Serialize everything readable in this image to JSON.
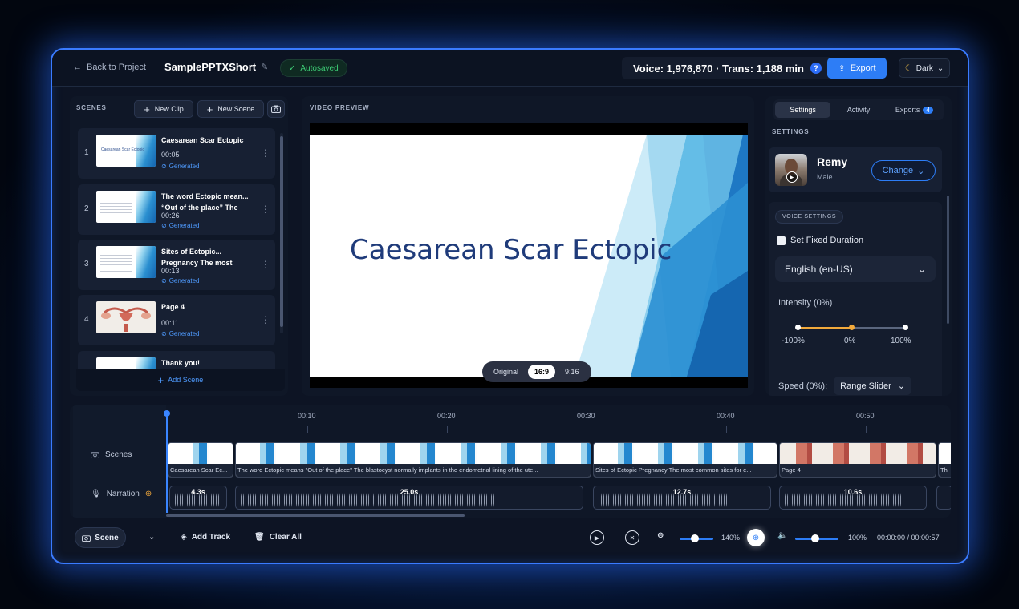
{
  "colors": {
    "accent": "#2d7df6",
    "success": "#3ecf77",
    "warning": "#f2a93b",
    "frame_glow": "#3a7bff"
  },
  "topbar": {
    "back_label": "Back to Project",
    "project_title": "SamplePPTXShort",
    "autosaved": "Autosaved",
    "usage": "Voice: 1,976,870 · Trans: 1,188 min",
    "help_icon": "?",
    "export_label": "Export",
    "theme_label": "Dark"
  },
  "scenes": {
    "label": "SCENES",
    "new_clip": "New Clip",
    "new_scene": "New Scene",
    "add_scene": "Add Scene",
    "items": [
      {
        "num": "1",
        "title": "Caesarean Scar Ectopic",
        "time": "00:05",
        "status": "Generated"
      },
      {
        "num": "2",
        "title": "The word Ectopic mean... “Out of the place” The",
        "time": "00:26",
        "status": "Generated"
      },
      {
        "num": "3",
        "title": "Sites of Ectopic... Pregnancy The most",
        "time": "00:13",
        "status": "Generated"
      },
      {
        "num": "4",
        "title": "Page 4",
        "time": "00:11",
        "status": "Generated"
      },
      {
        "num": "",
        "title": "Thank you!",
        "time": "",
        "status": ""
      }
    ],
    "thumb_title": "Caesarean Scar Ectopic"
  },
  "preview": {
    "label": "VIDEO PREVIEW",
    "slide_title": "Caesarean Scar Ectopic",
    "ratios": [
      "Original",
      "16:9",
      "9:16"
    ],
    "active_ratio": "16:9"
  },
  "settings": {
    "tabs": [
      {
        "label": "Settings"
      },
      {
        "label": "Activity"
      },
      {
        "label": "Exports",
        "badge": "4"
      }
    ],
    "section_label": "SETTINGS",
    "voice_name": "Remy",
    "voice_gender": "Male",
    "change_label": "Change",
    "voice_settings_chip": "VOICE SETTINGS",
    "fixed_duration": "Set Fixed Duration",
    "language": "English (en-US)",
    "intensity_label": "Intensity (0%)",
    "intensity_ticks": [
      "-100%",
      "0%",
      "100%"
    ],
    "intensity_value": 0,
    "speed_label": "Speed (0%):",
    "speed_select": "Range Slider"
  },
  "timeline": {
    "ticks": [
      "00:10",
      "00:20",
      "00:30",
      "00:40",
      "00:50"
    ],
    "scenes_label": "Scenes",
    "narration_label": "Narration",
    "clips": [
      {
        "caption": "Caesarean Scar Ec..."
      },
      {
        "caption": "The word Ectopic means \"Out of the place\" The blastocyst normally implants in the endometrial lining of the ute..."
      },
      {
        "caption": "Sites of Ectopic Pregnancy The most common sites for e..."
      },
      {
        "caption": "Page 4"
      },
      {
        "caption": "Th"
      }
    ],
    "narration": [
      {
        "duration": "4.3s"
      },
      {
        "duration": "25.0s"
      },
      {
        "duration": "12.7s"
      },
      {
        "duration": "10.6s"
      }
    ]
  },
  "bottombar": {
    "scene_label": "Scene",
    "add_track": "Add Track",
    "clear_all": "Clear All",
    "zoom": "140%",
    "volume": "100%",
    "time": "00:00:00 / 00:00:57"
  }
}
